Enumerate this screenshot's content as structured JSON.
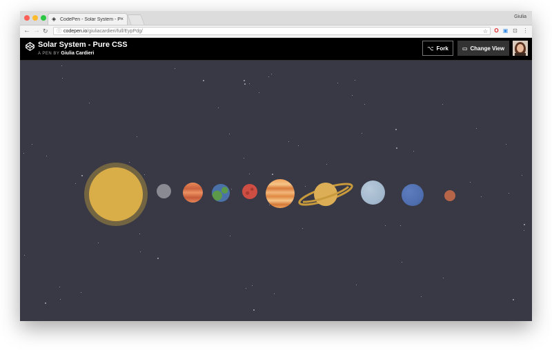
{
  "browser": {
    "tab_title": "CodePen - Solar System - Pur",
    "tab_close": "×",
    "user": "Giulia",
    "url_host": "codepen.io",
    "url_path": "/giuliacardieri/full/EypPdg/",
    "icons": [
      "back-arrow-icon",
      "forward-arrow-icon",
      "reload-icon",
      "info-icon",
      "bookmark-star-icon",
      "opera-icon",
      "extension-icon",
      "cast-icon",
      "menu-icon"
    ]
  },
  "codepen": {
    "pen_title": "Solar System - Pure CSS",
    "author_prefix": "A PEN BY",
    "author_name": "Giulia Cardieri",
    "fork_label": "Fork",
    "change_view_label": "Change View"
  },
  "scene": {
    "background": "#393946",
    "bodies": [
      "sun",
      "mercury",
      "venus",
      "earth",
      "mars",
      "jupiter",
      "saturn",
      "uranus",
      "neptune",
      "pluto"
    ],
    "colors": {
      "sun": "#d9ad48",
      "sun_glow": "#7a6a40",
      "mercury": "#8a8a92",
      "venus": "#e07a4b",
      "earth": "#4a72a8",
      "mars": "#cf4e43",
      "jupiter": "#e8964a",
      "saturn": "#dcae55",
      "uranus": "#a5bace",
      "neptune": "#4f6fb0",
      "pluto": "#b76548"
    }
  }
}
